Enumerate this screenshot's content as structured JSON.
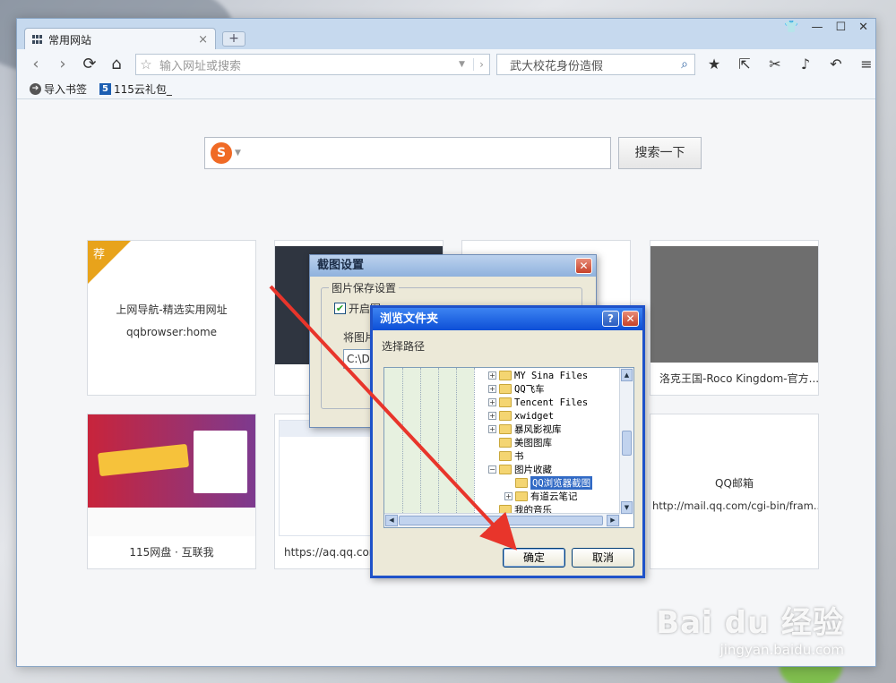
{
  "tab": {
    "title": "常用网站",
    "close": "×",
    "new_tab": "+"
  },
  "window_controls": {
    "skin": "👕",
    "minimize": "—",
    "maximize": "☐",
    "close": "✕"
  },
  "toolbar": {
    "back": "‹",
    "forward": "›",
    "refresh": "⟳",
    "home": "⌂",
    "address_placeholder": "输入网址或搜索",
    "search_value": "武大校花身份造假"
  },
  "bookmarks": [
    {
      "label": "导入书签",
      "icon": "import-icon"
    },
    {
      "label": "115云礼包_",
      "icon": "115-logo-icon"
    }
  ],
  "home": {
    "search_button": "搜索一下",
    "tiles": [
      {
        "title": "上网导航-精选实用网址",
        "subtitle": "qqbrowser:home",
        "badge": "荐"
      },
      {
        "caption": ""
      },
      {
        "caption": ""
      },
      {
        "caption": "洛克王国-Roco Kingdom-官方..."
      },
      {
        "caption": "115网盘 · 互联我"
      },
      {
        "caption": "https://aq.qq.com"
      },
      {
        "caption": ""
      },
      {
        "title": "QQ邮箱",
        "subtitle": "http://mail.qq.com/cgi-bin/fram..."
      }
    ]
  },
  "screenshot_dialog": {
    "title": "截图设置",
    "group_label": "图片保存设置",
    "checkbox_label": "开启图",
    "path_label": "将图片",
    "path_value": "C:\\Do"
  },
  "browse_dialog": {
    "title": "浏览文件夹",
    "prompt": "选择路径",
    "folders": [
      {
        "name": "MY Sina Files",
        "expand": "+"
      },
      {
        "name": "QQ飞车",
        "expand": "+"
      },
      {
        "name": "Tencent Files",
        "expand": "+"
      },
      {
        "name": "xwidget",
        "expand": "+"
      },
      {
        "name": "暴风影视库",
        "expand": "+"
      },
      {
        "name": "美图图库",
        "expand": ""
      },
      {
        "name": "书",
        "expand": ""
      },
      {
        "name": "图片收藏",
        "expand": "−"
      },
      {
        "name": "QQ浏览器截图",
        "expand": "",
        "selected": true
      },
      {
        "name": "有道云笔记",
        "expand": "+"
      },
      {
        "name": "我的音乐",
        "expand": ""
      }
    ],
    "ok_label": "确定",
    "cancel_label": "取消"
  },
  "watermark": {
    "brand": "Bai du 经验",
    "url": "jingyan.baidu.com"
  },
  "colors": {
    "arrow": "#e8352b",
    "accent": "#1f52c9",
    "badge": "#e8a31b"
  }
}
